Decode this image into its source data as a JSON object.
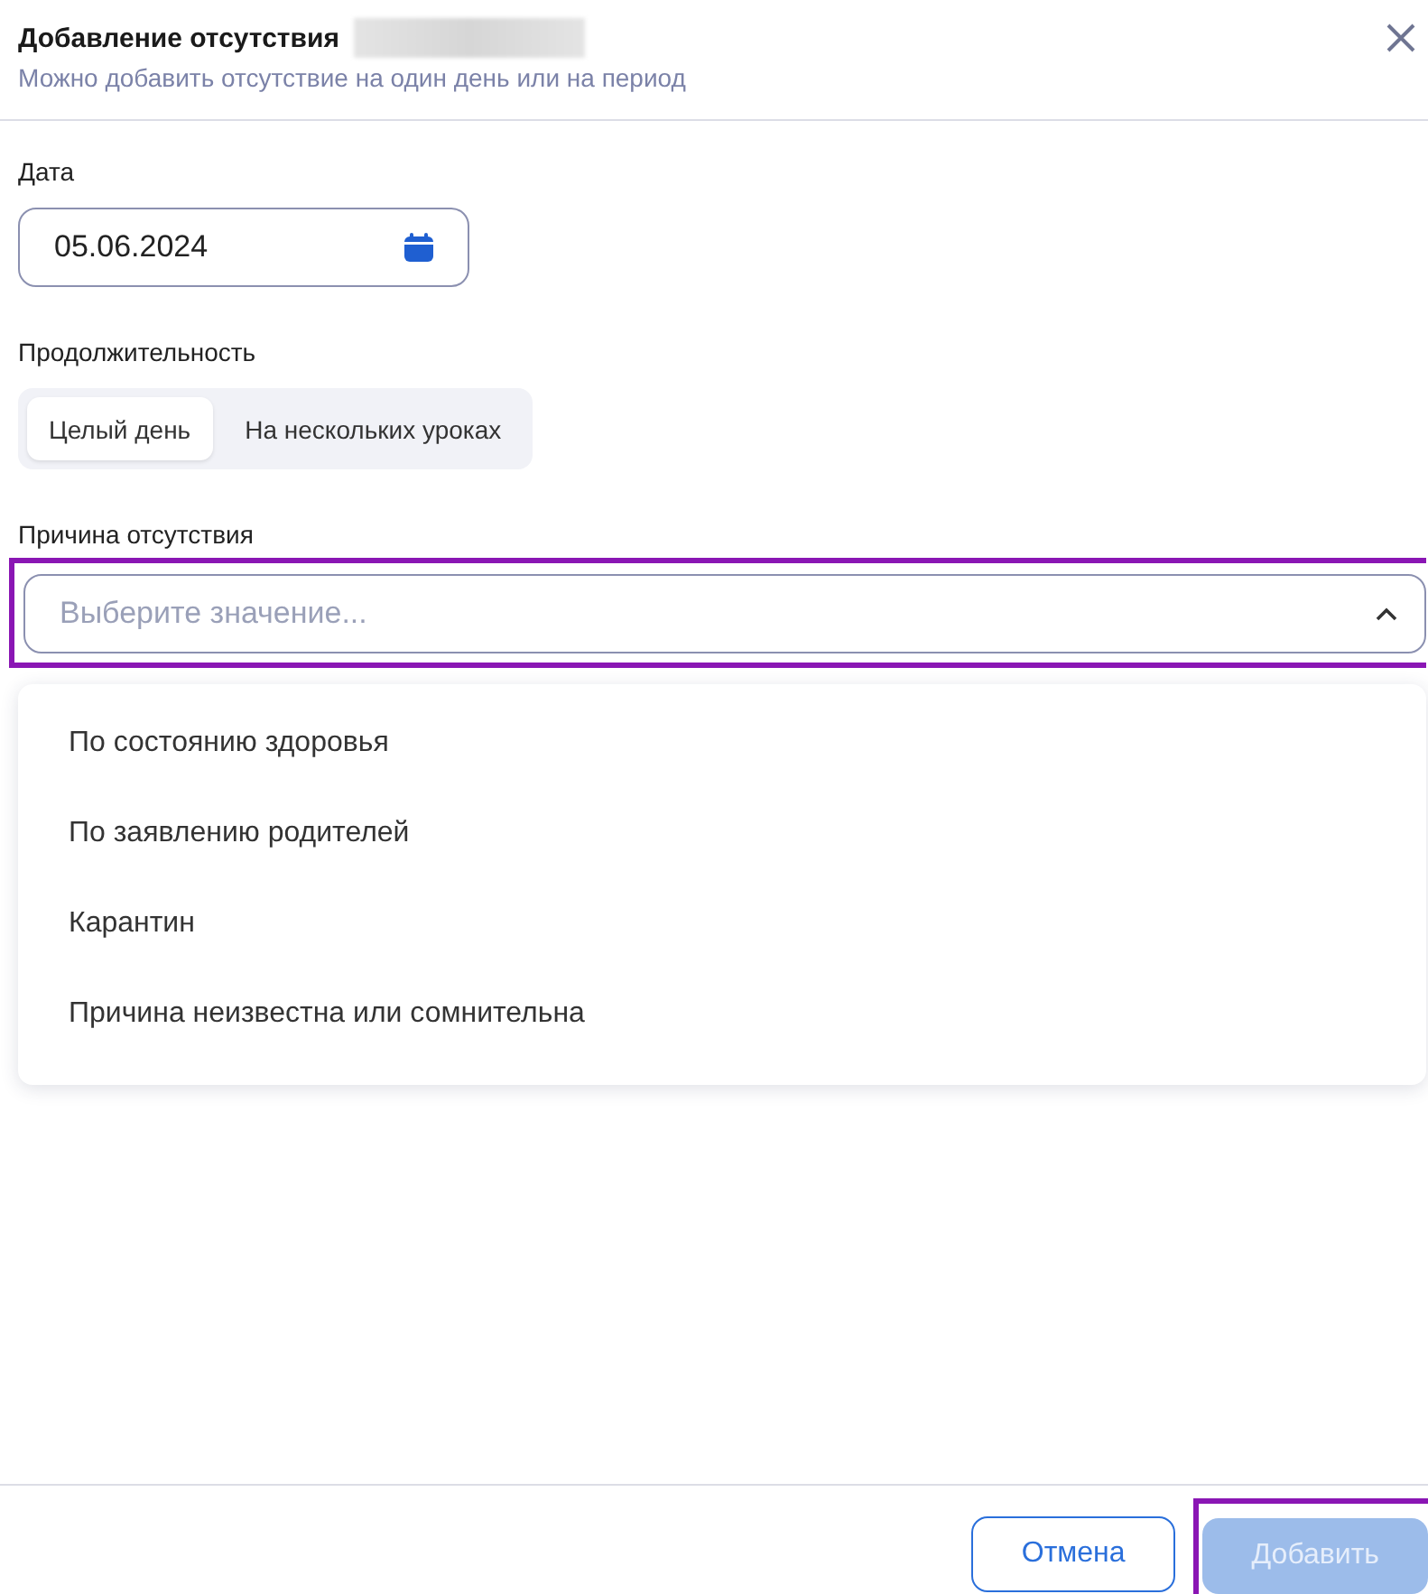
{
  "dialog": {
    "title": "Добавление отсутствия",
    "title_redacted": true,
    "subtitle": "Можно добавить отсутствие на один день или на период"
  },
  "date": {
    "label": "Дата",
    "value": "05.06.2024"
  },
  "duration": {
    "label": "Продолжительность",
    "options": [
      {
        "label": "Целый день",
        "selected": true
      },
      {
        "label": "На нескольких уроках",
        "selected": false
      }
    ]
  },
  "reason": {
    "label": "Причина отсутствия",
    "placeholder": "Выберите значение...",
    "expanded": true,
    "highlighted": true,
    "options": [
      {
        "label": "По состоянию здоровья"
      },
      {
        "label": "По заявлению родителей"
      },
      {
        "label": "Карантин"
      },
      {
        "label": "Причина неизвестна или сомнительна"
      }
    ]
  },
  "buttons": [
    {
      "kind": "secondary",
      "label": "Отмена",
      "highlighted": false
    },
    {
      "kind": "primary",
      "label": "Добавить",
      "disabled": true,
      "highlighted": true
    }
  ]
}
